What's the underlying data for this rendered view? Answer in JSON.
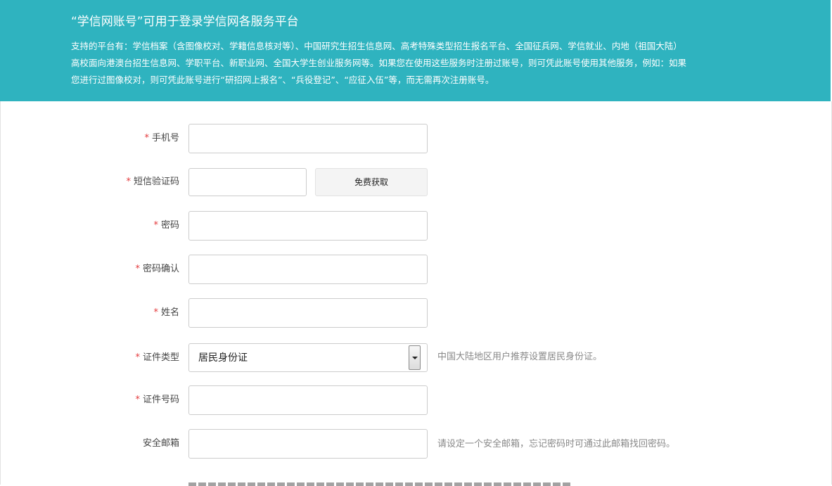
{
  "banner": {
    "title": "“学信网账号”可用于登录学信网各服务平台",
    "description": "支持的平台有：学信档案（含图像校对、学籍信息核对等）、中国研究生招生信息网、高考特殊类型招生报名平台、全国征兵网、学信就业、内地（祖国大陆）\n高校面向港澳台招生信息网、学职平台、新职业网、全国大学生创业服务网等。如果您在使用这些服务时注册过账号，则可凭此账号使用其他服务，例如：如果\n您进行过图像校对，则可凭此账号进行“研招网上报名”、“兵役登记”、“应征入伍”等，而无需再次注册账号。"
  },
  "form": {
    "required_mark": "*",
    "phone_label": "手机号",
    "sms_label": "短信验证码",
    "sms_button": "免费获取",
    "password_label": "密码",
    "password_confirm_label": "密码确认",
    "name_label": "姓名",
    "id_type_label": "证件类型",
    "id_type_value": "居民身份证",
    "id_type_hint": "中国大陆地区用户推荐设置居民身份证。",
    "id_number_label": "证件号码",
    "email_label": "安全邮箱",
    "email_hint": "请设定一个安全邮箱，忘记密码时可通过此邮箱找回密码。"
  },
  "colors": {
    "banner_bg": "#2fb3bf",
    "required": "#e4393c"
  }
}
